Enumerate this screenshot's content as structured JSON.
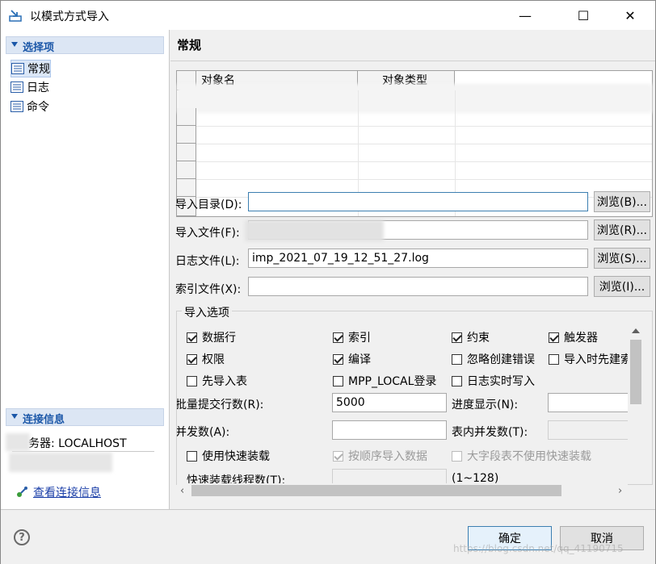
{
  "window": {
    "title": "以模式方式导入",
    "minimize": "—",
    "maximize": "☐",
    "close": "✕"
  },
  "sidebar": {
    "section1": "选择项",
    "items": [
      {
        "label": "常规",
        "selected": true
      },
      {
        "label": "日志",
        "selected": false
      },
      {
        "label": "命令",
        "selected": false
      }
    ],
    "section2": "连接信息",
    "server": "务器: LOCALHOST",
    "link": "查看连接信息"
  },
  "main": {
    "title": "常规",
    "table": {
      "columns": [
        "对象名",
        "对象类型"
      ]
    },
    "fields": [
      {
        "label": "导入目录(D):",
        "value": "",
        "button": "浏览(B)..."
      },
      {
        "label": "导入文件(F):",
        "value": "",
        "button": "浏览(R)..."
      },
      {
        "label": "日志文件(L):",
        "value": "imp_2021_07_19_12_51_27.log",
        "button": "浏览(S)..."
      },
      {
        "label": "索引文件(X):",
        "value": "",
        "button": "浏览(I)..."
      }
    ],
    "options": {
      "title": "导入选项",
      "checkboxes": [
        {
          "label": "数据行",
          "checked": true,
          "disabled": false
        },
        {
          "label": "索引",
          "checked": true,
          "disabled": false
        },
        {
          "label": "约束",
          "checked": true,
          "disabled": false
        },
        {
          "label": "触发器",
          "checked": true,
          "disabled": false
        },
        {
          "label": "权限",
          "checked": true,
          "disabled": false
        },
        {
          "label": "编译",
          "checked": true,
          "disabled": false
        },
        {
          "label": "忽略创建错误",
          "checked": false,
          "disabled": false
        },
        {
          "label": "导入时先建索",
          "checked": false,
          "disabled": false
        },
        {
          "label": "先导入表",
          "checked": false,
          "disabled": false
        },
        {
          "label": "MPP_LOCAL登录",
          "checked": false,
          "disabled": false
        },
        {
          "label": "日志实时写入",
          "checked": false,
          "disabled": false
        },
        {
          "label": "使用快速装载",
          "checked": false,
          "disabled": false
        },
        {
          "label": "按顺序导入数据",
          "checked": true,
          "disabled": true
        },
        {
          "label": "大字段表不使用快速装载",
          "checked": false,
          "disabled": true
        }
      ],
      "batch_label": "批量提交行数(R):",
      "batch_value": "5000",
      "progress_label": "进度显示(N):",
      "progress_value": "",
      "parallel_label": "并发数(A):",
      "parallel_value": "",
      "table_parallel_label": "表内并发数(T):",
      "table_parallel_value": "",
      "fast_threads_label": "快速装载线程数(T):",
      "fast_threads_range": "(1~128)"
    }
  },
  "footer": {
    "help": "?",
    "ok": "确定",
    "cancel": "取消",
    "watermark": "https://blog.csdn.net/qq_41190715"
  }
}
